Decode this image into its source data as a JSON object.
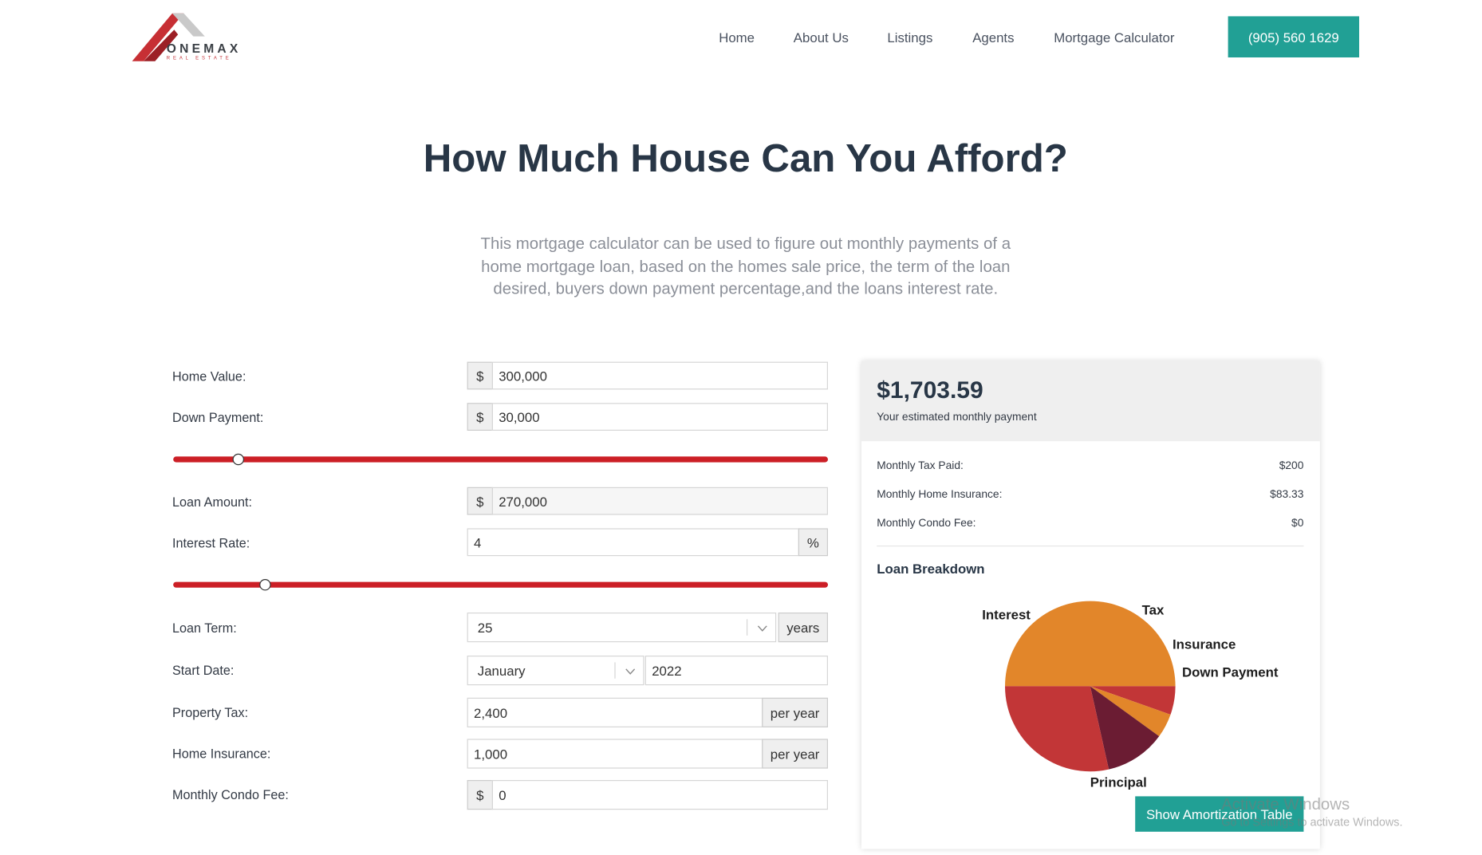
{
  "logo": {
    "name": "ONEMAX",
    "subtitle": "REAL ESTATE"
  },
  "nav": {
    "items": [
      "Home",
      "About Us",
      "Listings",
      "Agents",
      "Mortgage Calculator"
    ],
    "phone": "(905) 560 1629"
  },
  "hero": {
    "title": "How Much House Can You Afford?",
    "subtitle": "This mortgage calculator can be used to figure out monthly payments of a home mortgage loan, based on the homes sale price, the term of the loan desired, buyers down payment percentage,and the loans interest rate."
  },
  "form": {
    "home_value": {
      "label": "Home Value:",
      "prefix": "$",
      "value": "300,000"
    },
    "down_payment": {
      "label": "Down Payment:",
      "prefix": "$",
      "value": "30,000",
      "slider_fraction": 0.1
    },
    "loan_amount": {
      "label": "Loan Amount:",
      "prefix": "$",
      "value": "270,000"
    },
    "interest_rate": {
      "label": "Interest Rate:",
      "value": "4",
      "suffix": "%",
      "slider_fraction": 0.14
    },
    "loan_term": {
      "label": "Loan Term:",
      "value": "25",
      "suffix": "years"
    },
    "start_date": {
      "label": "Start Date:",
      "month": "January",
      "year": "2022"
    },
    "property_tax": {
      "label": "Property Tax:",
      "value": "2,400",
      "suffix": "per year"
    },
    "home_insurance": {
      "label": "Home Insurance:",
      "value": "1,000",
      "suffix": "per year"
    },
    "condo_fee": {
      "label": "Monthly Condo Fee:",
      "prefix": "$",
      "value": "0"
    }
  },
  "result": {
    "monthly_payment": "$1,703.59",
    "monthly_payment_label": "Your estimated monthly payment",
    "rows": [
      {
        "label": "Monthly Tax Paid:",
        "value": "$200"
      },
      {
        "label": "Monthly Home Insurance:",
        "value": "$83.33"
      },
      {
        "label": "Monthly Condo Fee:",
        "value": "$0"
      }
    ],
    "breakdown_title": "Loan Breakdown",
    "amortization_button": "Show Amortization Table"
  },
  "chart_data": {
    "type": "pie",
    "series": [
      {
        "name": "Principal",
        "value": 50.0,
        "color": "#e2862a"
      },
      {
        "name": "Interest",
        "value": 28.5,
        "color": "#c23637"
      },
      {
        "name": "Tax",
        "value": 11.5,
        "color": "#6b1c33"
      },
      {
        "name": "Insurance",
        "value": 4.6,
        "color": "#e2862a"
      },
      {
        "name": "Down Payment",
        "value": 5.4,
        "color": "#c23637"
      }
    ],
    "legend": "labels-around"
  },
  "watermark": {
    "line1": "Activate Windows",
    "line2": "Go to Settings to activate Windows."
  },
  "colors": {
    "accent": "#21a095",
    "slider": "#cc1f26",
    "heading": "#283646"
  }
}
